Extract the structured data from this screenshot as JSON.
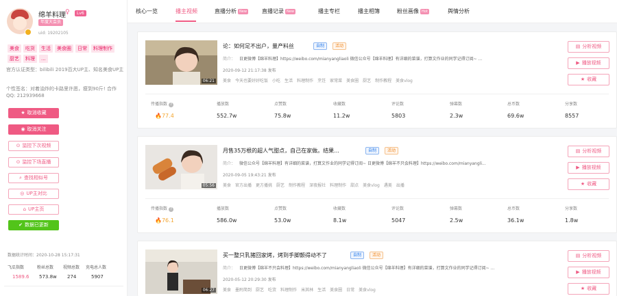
{
  "profile": {
    "name": "绵羊料理",
    "gender_icon": "♀",
    "level": "Lv6",
    "year_badge": "年度大会员",
    "uid": "uid: 19202105",
    "tags": [
      "美食",
      "吃货",
      "生活",
      "美食圈",
      "日常",
      "料理制作",
      "厨艺",
      "料理",
      "..."
    ],
    "certification": "官方认证类型：bilibili 2019百大UP主、知名美食UP主",
    "signature": "个性签名：对着油炸的卡路里许愿，瘦到90斤! 合作QQ: 212939668"
  },
  "actions": {
    "cancel_favorite": "取消收藏",
    "cancel_follow": "取消关注",
    "monitor_next_video": "监控下次视频",
    "monitor_next_live": "监控下场直播",
    "find_similar": "查找相似号",
    "compare": "UP主对比",
    "home": "UP主页",
    "data_updated": "数据已更新"
  },
  "summary": {
    "stat_time": "数据统计时间：2020-10-28 15:17:31",
    "labels": [
      "飞瓜指数",
      "粉丝总数",
      "视频总数",
      "充电总人数"
    ],
    "values": [
      "1589.6",
      "573.8w",
      "274",
      "5907"
    ]
  },
  "tabs": [
    {
      "label": "核心一览",
      "badge": ""
    },
    {
      "label": "播主视频",
      "badge": ""
    },
    {
      "label": "直播分析",
      "badge": "New"
    },
    {
      "label": "直播记录",
      "badge": "New"
    },
    {
      "label": "播主专栏",
      "badge": ""
    },
    {
      "label": "播主相簿",
      "badge": ""
    },
    {
      "label": "粉丝画像",
      "badge": "Hot"
    },
    {
      "label": "舆情分析",
      "badge": ""
    }
  ],
  "card_actions": {
    "analyze": "分析视频",
    "play": "播放视频",
    "favorite": "收藏"
  },
  "stat_labels": [
    "传播指数",
    "播放数",
    "点赞数",
    "收藏数",
    "评论数",
    "弹幕数",
    "总币数",
    "分享数"
  ],
  "videos": [
    {
      "title": "论：如何足不出户，量产料丝",
      "badge_self": "自制",
      "badge_event": "活动",
      "desc_label": "简介：",
      "desc": "日更微博【绵羊料理】https://weibo.com/mianyangliaoli 微信公众号【绵羊料理】有详细的菜谱，打算文作业的同学记得订阅~ ...",
      "published": "2020-09-12 21:17:38 发布",
      "duration": "06:21",
      "tags": [
        "美食",
        "今天也要好好吃饭",
        "小吃",
        "生活",
        "料理制作",
        "烹饪",
        "家常菜",
        "美食圈",
        "厨艺",
        "制作教程",
        "美食vlog"
      ],
      "stats": [
        "77.4",
        "552.7w",
        "75.8w",
        "11.2w",
        "5803",
        "2.3w",
        "69.6w",
        "8557"
      ]
    },
    {
      "title": "月售35万根的超人气甜点，自己在家做。结果...",
      "badge_self": "自制",
      "badge_event": "活动",
      "desc_label": "简介：",
      "desc": "微信公众号【绵羊料理】有详细的菜谱，打算文作业的同学记得订阅~ 日更微博【绵羊不只会料理】https://weibo.com/mianyangli...",
      "published": "2020-09-05 19:43:21 发布",
      "duration": "05:56",
      "tags": [
        "美食",
        "官方出播",
        "更方播挑",
        "厨艺",
        "制作教程",
        "深夜报社",
        "料理制作",
        "甜点",
        "美食vlog",
        "遇美",
        "出播"
      ],
      "stats": [
        "76.1",
        "586.0w",
        "53.0w",
        "8.1w",
        "5047",
        "2.5w",
        "36.1w",
        "1.8w"
      ]
    },
    {
      "title": "买一整只乳猪回家烤，烤到手脚颤得动不了",
      "badge_self": "自制",
      "badge_event": "活动",
      "desc_label": "简介：",
      "desc": "日更微博【绵羊不只会料理】https://weibo.com/mianyangliaoli 微信公众号【绵羊料理】有详细的菜谱，打算文作业的同学记得订阅~ ...",
      "published": "2020-05-12 20:29:30 发布",
      "duration": "06:27",
      "tags": [
        "美食",
        "墨附简到",
        "厨艺",
        "吃货",
        "料理制作",
        "米其林",
        "生活",
        "美食圈",
        "日常",
        "美食vlog"
      ],
      "stats": [
        "",
        "",
        "",
        "",
        "",
        "",
        "",
        ""
      ]
    }
  ],
  "colors": {
    "accent": "#ef5a83",
    "index": "#f3a530",
    "green": "#52c41a"
  }
}
